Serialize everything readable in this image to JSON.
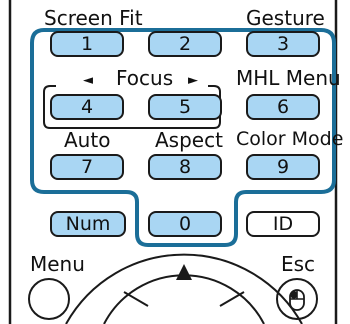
{
  "colors": {
    "key_fill": "#a9d6f3",
    "highlight_border": "#1b6e98",
    "outline": "#1a1a1a"
  },
  "labels": {
    "screen_fit": "Screen Fit",
    "gesture": "Gesture",
    "focus": "Focus",
    "focus_left_arrow": "◄",
    "focus_right_arrow": "►",
    "mhl_menu": "MHL Menu",
    "auto": "Auto",
    "aspect": "Aspect",
    "color_mode": "Color Mode",
    "menu": "Menu",
    "esc": "Esc"
  },
  "keys": {
    "k1": "1",
    "k2": "2",
    "k3": "3",
    "k4": "4",
    "k5": "5",
    "k6": "6",
    "k7": "7",
    "k8": "8",
    "k9": "9",
    "num": "Num",
    "k0": "0",
    "id": "ID"
  },
  "icons": {
    "up_arrow": "up-arrow-icon",
    "mouse": "mouse-icon"
  }
}
